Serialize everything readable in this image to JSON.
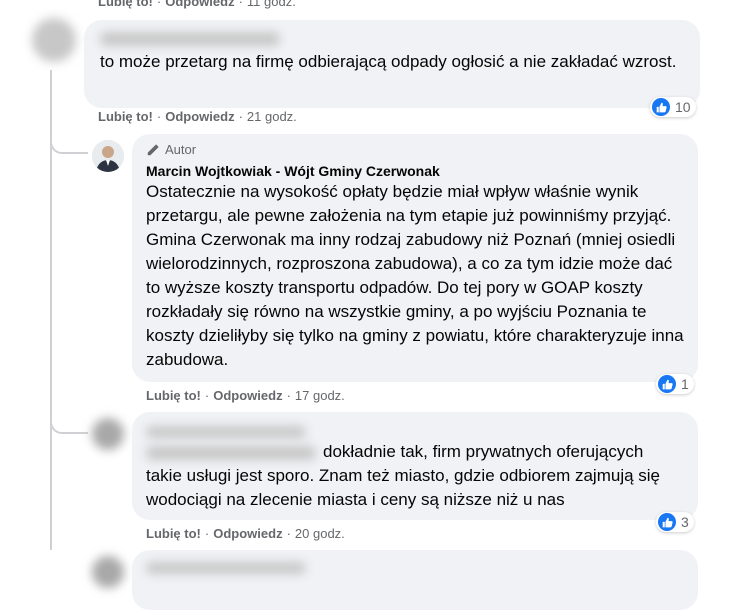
{
  "comments": [
    {
      "actions": {
        "like": "Lubię to!",
        "reply": "Odpowiedz",
        "time": "11 godz."
      }
    },
    {
      "name_partial": "…azimie…",
      "text": "to może przetarg na firmę odbierającą odpady ogłosić a nie zakładać wzrost.",
      "reactions": "10",
      "actions": {
        "like": "Lubię to!",
        "reply": "Odpowiedz",
        "time": "21 godz."
      }
    },
    {
      "badge": "Autor",
      "author": "Marcin Wojtkowiak - Wójt Gminy Czerwonak",
      "text": "Ostatecznie na wysokość opłaty będzie miał wpływ właśnie wynik przetargu, ale pewne założenia na tym etapie już powinniśmy przyjąć. Gmina Czerwonak ma inny rodzaj zabudowy niż Poznań (mniej osiedli wielorodzinnych, rozproszona zabudowa), a co za tym idzie może dać to wyższe koszty transportu odpadów. Do tej pory w GOAP koszty rozkładały się równo na wszystkie gminy, a po wyjściu Poznania te koszty dzieliłyby się tylko na gminy z powiatu, które charakteryzuje inna zabudowa.",
      "reactions": "1",
      "actions": {
        "like": "Lubię to!",
        "reply": "Odpowiedz",
        "time": "17 godz."
      }
    },
    {
      "text_line1": "dokładnie tak, firm prywatnych oferujących",
      "text_rest": "takie usługi jest sporo. Znam też miasto, gdzie odbiorem zajmują się wodociągi na zlecenie miasta i ceny są niższe niż u nas",
      "reactions": "3",
      "actions": {
        "like": "Lubię to!",
        "reply": "Odpowiedz",
        "time": "20 godz."
      }
    }
  ],
  "icons": {
    "like": "thumbs-up-icon",
    "badge": "pencil-icon"
  },
  "colors": {
    "bubble": "#f0f2f5",
    "like_blue": "#1877f2",
    "meta": "#65676b"
  }
}
